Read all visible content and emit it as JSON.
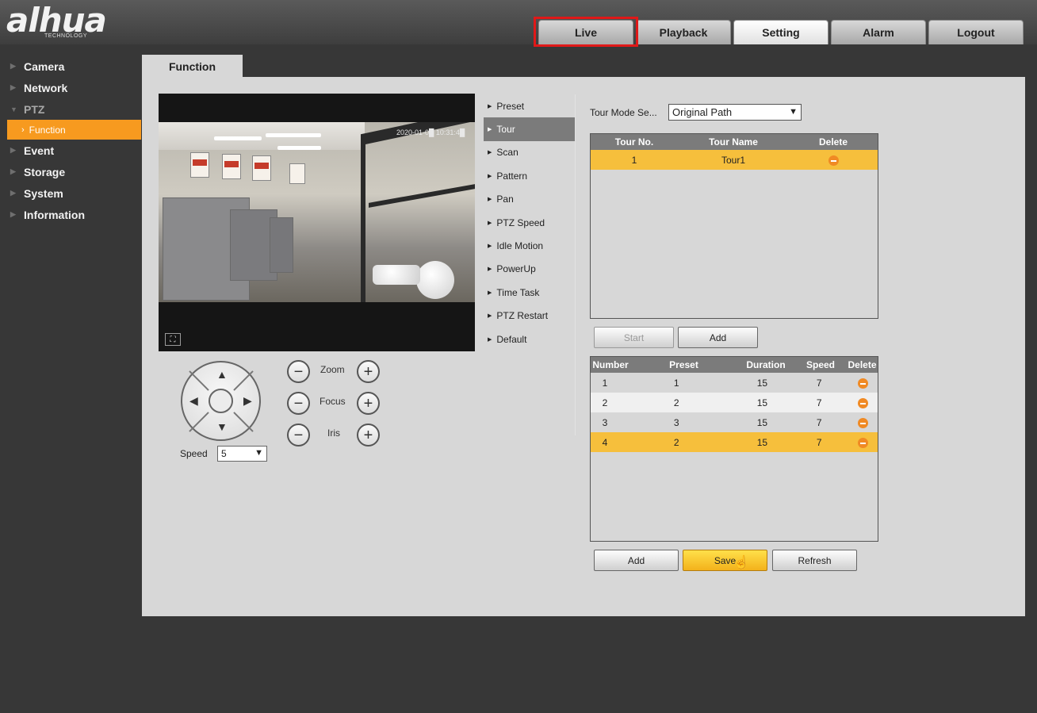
{
  "header": {
    "logo_main": "alhua",
    "logo_sub": "TECHNOLOGY",
    "tabs": [
      {
        "label": "Live"
      },
      {
        "label": "Playback"
      },
      {
        "label": "Setting"
      },
      {
        "label": "Alarm"
      },
      {
        "label": "Logout"
      }
    ],
    "active_tab": "Setting",
    "highlighted_tab": "Live"
  },
  "sidebar": {
    "items": [
      {
        "label": "Camera"
      },
      {
        "label": "Network"
      },
      {
        "label": "PTZ"
      },
      {
        "label": "Event"
      },
      {
        "label": "Storage"
      },
      {
        "label": "System"
      },
      {
        "label": "Information"
      }
    ],
    "sub_item": "Function",
    "accent_color": "#f79a1f"
  },
  "content": {
    "tab_label": "Function",
    "video": {
      "timestamp": "2020-01-0█ 10:31:4█"
    },
    "ptz": {
      "speed_label": "Speed",
      "speed_value": "5",
      "zoom_label": "Zoom",
      "focus_label": "Focus",
      "iris_label": "Iris",
      "minus": "−",
      "plus": "+"
    },
    "functions": [
      {
        "label": "Preset"
      },
      {
        "label": "Tour"
      },
      {
        "label": "Scan"
      },
      {
        "label": "Pattern"
      },
      {
        "label": "Pan"
      },
      {
        "label": "PTZ Speed"
      },
      {
        "label": "Idle Motion"
      },
      {
        "label": "PowerUp"
      },
      {
        "label": "Time Task"
      },
      {
        "label": "PTZ Restart"
      },
      {
        "label": "Default"
      }
    ],
    "active_function": "Tour",
    "tour": {
      "mode_label": "Tour Mode Se...",
      "mode_value": "Original Path",
      "tour_table": {
        "headers": [
          "Tour No.",
          "Tour Name",
          "Delete"
        ],
        "rows": [
          {
            "no": "1",
            "name": "Tour1"
          }
        ]
      },
      "start_button": "Start",
      "add_tour_button": "Add",
      "preset_table": {
        "headers": [
          "Number",
          "Preset",
          "Duration",
          "Speed",
          "Delete"
        ],
        "rows": [
          {
            "number": "1",
            "preset": "1",
            "duration": "15",
            "speed": "7"
          },
          {
            "number": "2",
            "preset": "2",
            "duration": "15",
            "speed": "7"
          },
          {
            "number": "3",
            "preset": "3",
            "duration": "15",
            "speed": "7"
          },
          {
            "number": "4",
            "preset": "2",
            "duration": "15",
            "speed": "7"
          }
        ]
      },
      "add_button": "Add",
      "save_button": "Save",
      "refresh_button": "Refresh"
    }
  }
}
